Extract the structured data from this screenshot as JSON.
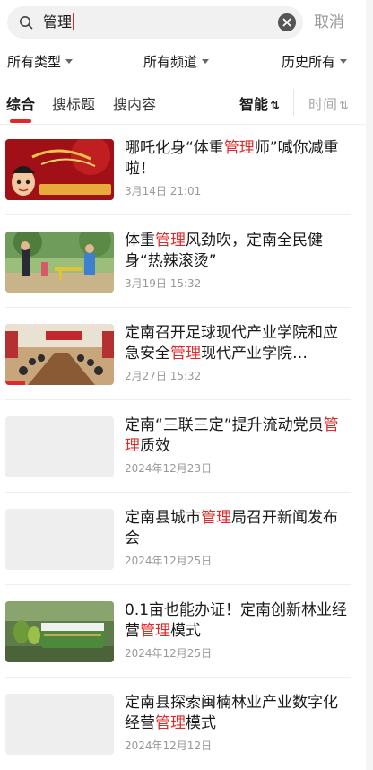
{
  "search": {
    "query": "管理",
    "cancel_label": "取消"
  },
  "filters": {
    "type": "所有类型",
    "channel": "所有频道",
    "history": "历史所有"
  },
  "tabs": [
    {
      "label": "综合",
      "active": true
    },
    {
      "label": "搜标题",
      "active": false
    },
    {
      "label": "搜内容",
      "active": false
    }
  ],
  "sort": {
    "smart_label": "智能",
    "time_label": "时间",
    "arrows": "⇅"
  },
  "results": [
    {
      "title_parts": [
        "哪吒化身“体重",
        "管理",
        "师”喊你减重啦！"
      ],
      "date": "3月14日 21:01",
      "thumb": "nezha"
    },
    {
      "title_parts": [
        "体重",
        "管理",
        "风劲吹，定南全民健身“热辣滚烫”"
      ],
      "date": "3月19日 15:32",
      "thumb": "exercise"
    },
    {
      "title_parts": [
        "定南召开足球现代产业学院和应急安全",
        "管理",
        "现代产业学院…"
      ],
      "date": "2月27日 15:32",
      "thumb": "meeting"
    },
    {
      "title_parts": [
        "定南“三联三定”提升流动党员",
        "管理",
        "质效"
      ],
      "date": "2024年12月23日",
      "thumb": "placeholder"
    },
    {
      "title_parts": [
        "定南县城市",
        "管理",
        "局召开新闻发布会"
      ],
      "date": "2024年12月25日",
      "thumb": "placeholder"
    },
    {
      "title_parts": [
        "0.1亩也能办证！定南创新林业经营",
        "管理",
        "模式"
      ],
      "date": "2024年12月25日",
      "thumb": "forest",
      "thumb_sign": "万亩闽楠基地"
    },
    {
      "title_parts": [
        "定南县探索闽楠林业产业数字化经营",
        "管理",
        "模式"
      ],
      "date": "2024年12月12日",
      "thumb": "placeholder"
    }
  ],
  "colors": {
    "accent": "#e02a2a",
    "muted": "#999999"
  }
}
